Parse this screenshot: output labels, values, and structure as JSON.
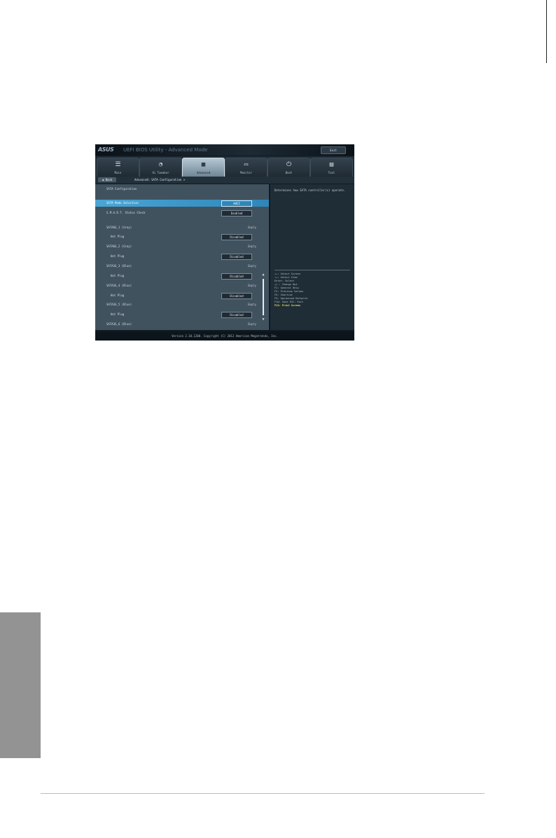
{
  "bios": {
    "brand": "ASUS",
    "title": "UEFI BIOS Utility - Advanced Mode",
    "exit_label": "Exit",
    "tabs": [
      {
        "label": "Main",
        "icon": "list-icon",
        "glyph": "☰"
      },
      {
        "label": "Ai Tweaker",
        "icon": "gauge-icon",
        "glyph": "◔"
      },
      {
        "label": "Advanced",
        "icon": "chip-icon",
        "glyph": "▦"
      },
      {
        "label": "Monitor",
        "icon": "monitor-icon",
        "glyph": "▭"
      },
      {
        "label": "Boot",
        "icon": "power-icon",
        "glyph": "⏻"
      },
      {
        "label": "Tool",
        "icon": "toolbox-icon",
        "glyph": "▤"
      }
    ],
    "active_tab": "Advanced",
    "back_label": "Back",
    "breadcrumb": "Advanced\\ SATA Configuration >",
    "section_title": "SATA Configuration",
    "settings": [
      {
        "label": "SATA Mode Selection",
        "option": "AHCI",
        "selected": true
      },
      {
        "label": "S.M.A.R.T. Status Check",
        "option": "Enabled"
      }
    ],
    "ports": [
      {
        "label": "SATA6G_1 (Gray)",
        "value": "Empty",
        "hot_plug_label": "Hot Plug",
        "hot_plug": "Disabled"
      },
      {
        "label": "SATA6G_2 (Gray)",
        "value": "Empty",
        "hot_plug_label": "Hot Plug",
        "hot_plug": "Disabled"
      },
      {
        "label": "SATA3G_3 (Blue)",
        "value": "Empty",
        "hot_plug_label": "Hot Plug",
        "hot_plug": "Disabled"
      },
      {
        "label": "SATA3G_4 (Blue)",
        "value": "Empty",
        "hot_plug_label": "Hot Plug",
        "hot_plug": "Disabled"
      },
      {
        "label": "SATA3G_5 (Blue)",
        "value": "Empty",
        "hot_plug_label": "Hot Plug",
        "hot_plug": "Disabled"
      },
      {
        "label": "SATA3G_6 (Blue)",
        "value": "Empty"
      }
    ],
    "help_text": "Determines how SATA controller(s) operate.",
    "key_help": [
      "→←: Select Screen",
      "↑↓: Select Item",
      "Enter: Select",
      "+/-: Change Opt.",
      "F1: General Help",
      "F2: Previous Values",
      "F5: Shortcut",
      "F5: Optimized Defaults",
      "F10: Save  ESC: Exit",
      "F12: Print Screen"
    ],
    "footer": "Version 2.10.1208. Copyright (C) 2012 American Megatrends, Inc.",
    "colors": {
      "highlight": "#3a9bd0",
      "hotkey": "#f2e34a"
    }
  }
}
